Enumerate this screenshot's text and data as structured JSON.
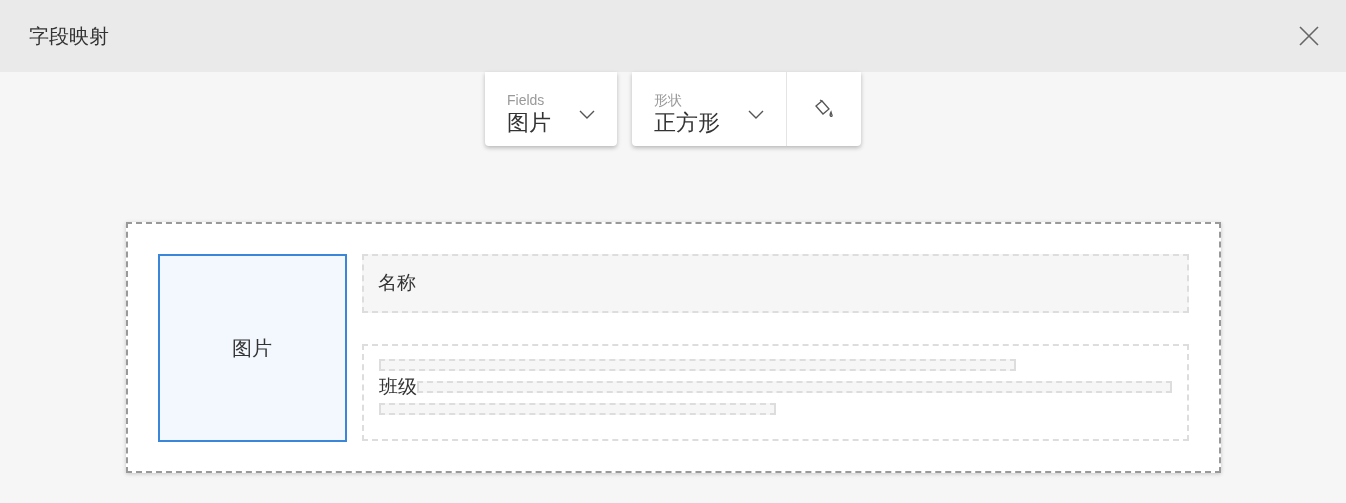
{
  "window": {
    "title": "字段映射"
  },
  "toolbar": {
    "fields": {
      "label": "Fields",
      "value": "图片"
    },
    "shape": {
      "label": "形状",
      "value": "正方形"
    }
  },
  "layout": {
    "slots": [
      {
        "kind": "image",
        "label": "图片",
        "selected": true
      },
      {
        "kind": "title",
        "label": "名称",
        "selected": false
      },
      {
        "kind": "lines",
        "label": "班级",
        "selected": false
      }
    ]
  }
}
